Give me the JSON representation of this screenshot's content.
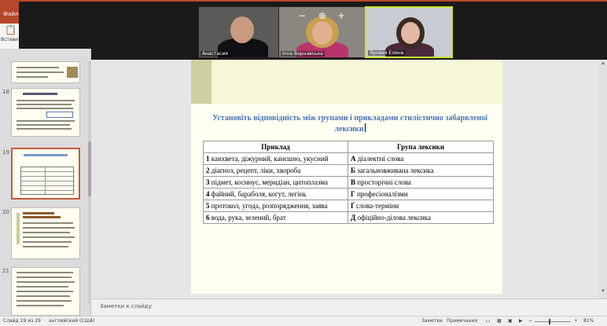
{
  "ribbon": {
    "file_tab": "Файл",
    "paste_label": "Вставит"
  },
  "video": {
    "participants": [
      {
        "name": "Анастасия"
      },
      {
        "name": "Inna Варнавська"
      },
      {
        "name": "Яровая Елена",
        "active": true
      }
    ],
    "zoom_in_symbol": "⊕",
    "plus_symbol": "+",
    "minus_symbol": "−"
  },
  "thumbnails": {
    "items": [
      {
        "number": "",
        "caption": "«Злоупотребление — это злоупотребление чужой доверчивостью или, особенно, родителя»"
      },
      {
        "number": "18",
        "caption": "Экспрессивно-стилистическая лексика"
      },
      {
        "number": "19",
        "caption": "Установіть відповідність",
        "selected": true
      },
      {
        "number": "20",
        "caption": "Прочитайте поздравление «Незабываемые соли»"
      },
      {
        "number": "21",
        "caption": ""
      }
    ]
  },
  "slide": {
    "title": "Установіть відповідність між групами і прикладами стилістично забарвленої лексики",
    "table": {
      "headers": [
        "Приклад",
        "Група лексики"
      ],
      "rows": [
        {
          "n": "1",
          "example": "канхвета, діжурний, канєшно, укусний",
          "letter": "А",
          "group": "діалектні слова"
        },
        {
          "n": "2",
          "example": "діагноз, рецепт, ліки, хвороба",
          "letter": "Б",
          "group": "загальновживана лексика"
        },
        {
          "n": "3",
          "example": "підмет, косинус, меридіан, цитоплазма",
          "letter": "В",
          "group": "просторічні слова"
        },
        {
          "n": "4",
          "example": "файний, бараболя, когут, легінь",
          "letter": "Г",
          "group": "професіоналізми"
        },
        {
          "n": "5",
          "example": "протокол, угода, розпорядження, заява",
          "letter": "Ґ",
          "group": "слова-терміни"
        },
        {
          "n": "6",
          "example": "вода, рука, зелений, брат",
          "letter": "Д",
          "group": "офіційно-ділова лексика"
        }
      ]
    }
  },
  "notes": {
    "placeholder": "Заметки к слайду"
  },
  "status": {
    "slide_counter": "Слайд 19 из 29",
    "language": "английский (США)",
    "notes_button": "Заметки",
    "comments_button": "Примечания",
    "zoom_level": "81%",
    "zoom_fraction": 0.81
  },
  "colors": {
    "ribbon": "#b7472a",
    "title": "#4a72b8",
    "slide_bg": "#fffff2",
    "active_speaker": "#c7e33a"
  }
}
